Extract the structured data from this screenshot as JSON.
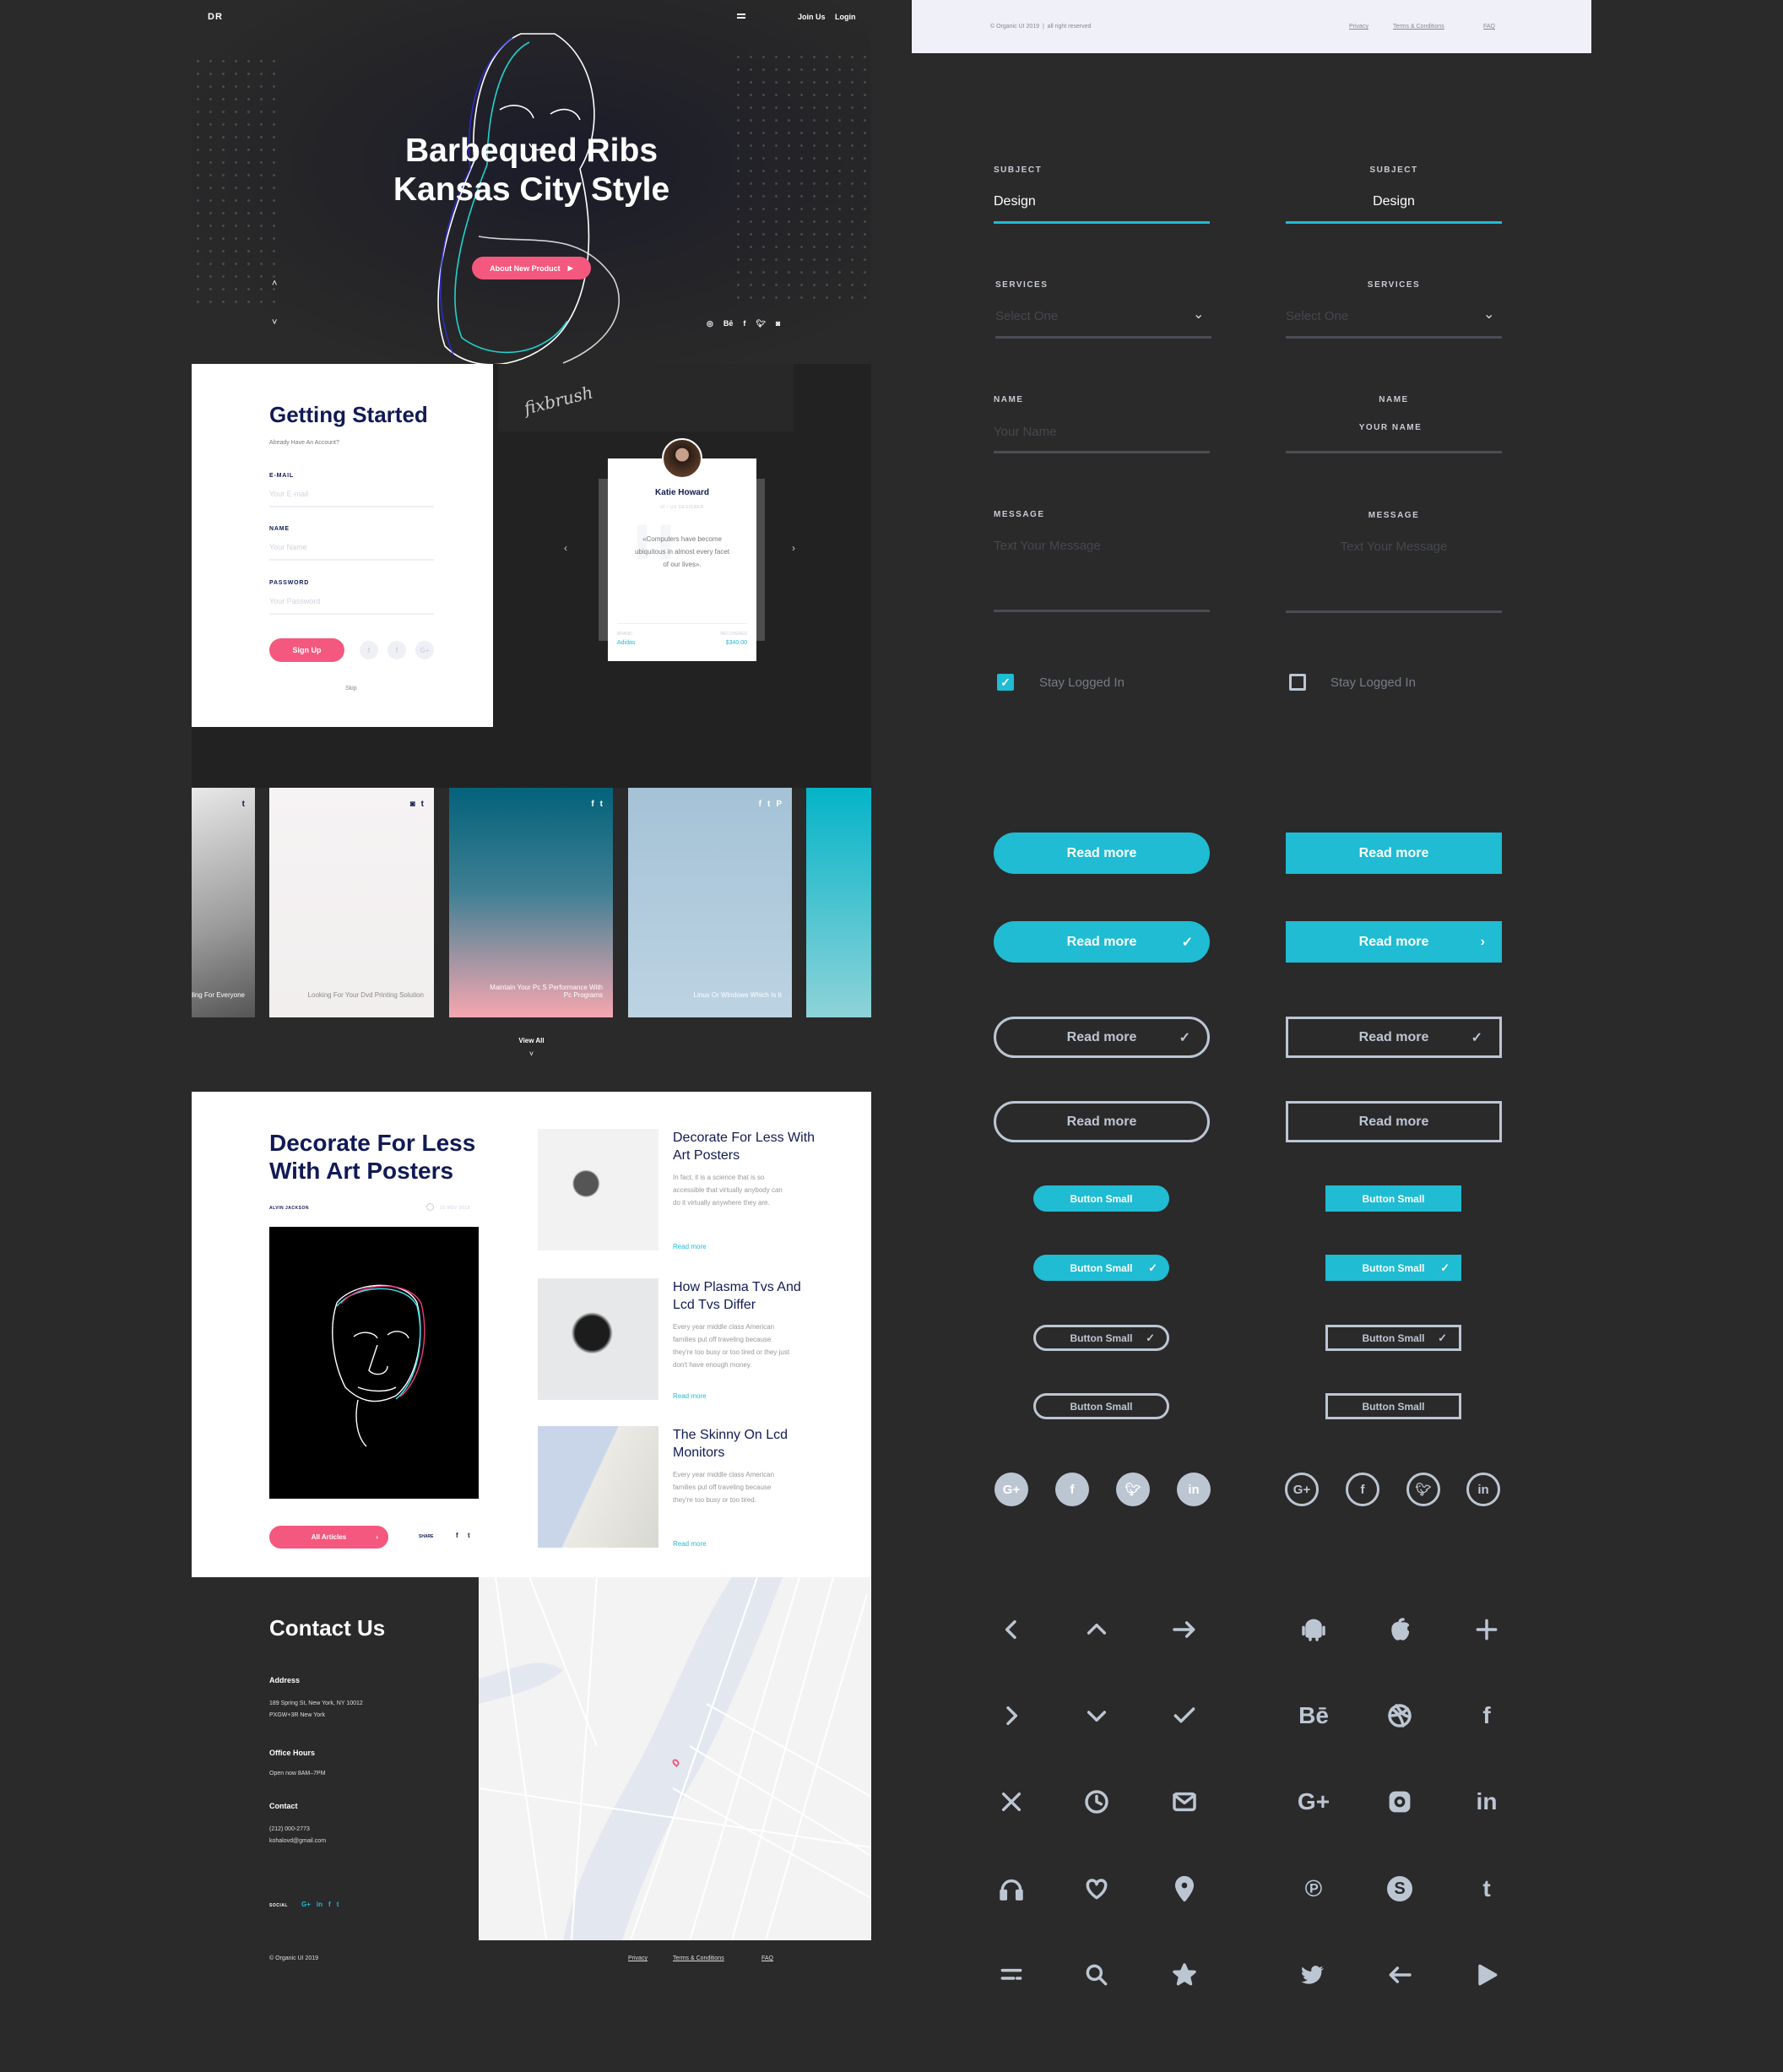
{
  "colors": {
    "accent": "#1fbcd3",
    "pink": "#f4587e",
    "navy": "#111a55",
    "dark": "#2a2a2a",
    "muted": "#bcc6d3"
  },
  "hero": {
    "logo": "DR",
    "nav": [
      "Join Us",
      "Login"
    ],
    "title_line1": "Barbequed Ribs",
    "title_line2": "Kansas City Style",
    "cta": "About New Product",
    "social_icons": [
      "dribbble-icon",
      "behance-icon",
      "facebook-icon",
      "twitter-icon",
      "instagram-icon"
    ],
    "signature": "fixbrush"
  },
  "signup": {
    "title": "Getting Started",
    "subtitle": "Already Have An Account?",
    "fields": [
      {
        "label": "E-MAIL",
        "placeholder": "Your E-mail"
      },
      {
        "label": "NAME",
        "placeholder": "Your Name"
      },
      {
        "label": "PASSWORD",
        "placeholder": "Your Password"
      }
    ],
    "button": "Sign Up",
    "socials": [
      "t",
      "f",
      "G+"
    ],
    "skip": "Skip"
  },
  "testimonial": {
    "name": "Katie Howard",
    "role": "UI / UX DESIGNER",
    "quote": "«Computers have become ubiquitous in almost every facet of our lives».",
    "brand_label": "BRAND:",
    "brand": "Adidas",
    "recovered_label": "RECOVERED",
    "amount": "$340.00"
  },
  "gallery": {
    "cards": [
      {
        "caption": "e Audio Recording For Everyone",
        "icons": [
          "twitter-icon"
        ],
        "bg": "linear-gradient(160deg,#e8e8e8,#9a9a9a 60%,#555)",
        "dark": true
      },
      {
        "caption": "Looking For Your Dvd Printing Solution",
        "icons": [
          "instagram-icon",
          "twitter-icon"
        ],
        "bg": "linear-gradient(#f6f3f4,#f1eeee)",
        "dark": true
      },
      {
        "caption": "Maintain Your Pc S Performance With Pc Programs",
        "icons": [
          "facebook-icon",
          "twitter-icon"
        ],
        "bg": "linear-gradient(#03627a,#3e7f93 45%,#f6a7b0)",
        "dark": false
      },
      {
        "caption": "Linux Or Windows Which Is It",
        "icons": [
          "facebook-icon",
          "twitter-icon",
          "pinterest-icon"
        ],
        "bg": "linear-gradient(#a5c2d6,#bcd3e3)",
        "dark": false
      },
      {
        "caption": "",
        "icons": [],
        "bg": "linear-gradient(#04b4c8,#8ed3d8)",
        "dark": false
      }
    ],
    "view_all": "View All"
  },
  "blog": {
    "title_line1": "Decorate For Less",
    "title_line2": "With Art Posters",
    "author": "ALVIN JACKSON",
    "date": "15 NOV 2019",
    "button": "All Articles",
    "share": "SHARE",
    "posts": [
      {
        "title": "Decorate For Less With Art Posters",
        "excerpt": "In fact, it is a science that is so accessible that virtually anybody can do it virtually anywhere they are.",
        "link": "Read more",
        "bg": "radial-gradient(circle at 40% 45%,#555 0 12%,#f2f2f2 14%)"
      },
      {
        "title": "How Plasma Tvs And Lcd Tvs Differ",
        "excerpt": "Every year middle class American families put off traveling because they're too busy or too tired or they just don't have enough money.",
        "link": "Read more",
        "bg": "radial-gradient(ellipse at 45% 45%,#1c1c1c 0 18%,#e6e8ea 22%)"
      },
      {
        "title": "The Skinny On Lcd Monitors",
        "excerpt": "Every year middle class American families put off traveling because they're too busy or too tired.",
        "link": "Read more",
        "bg": "linear-gradient(115deg,#c9d6ea 45%,#eceae4 46%,#d8d8d2)"
      }
    ]
  },
  "contact": {
    "title": "Contact Us",
    "sections": [
      {
        "heading": "Address",
        "lines": [
          "189 Spring St, New York, NY 10012",
          "PXGW+3R New York"
        ]
      },
      {
        "heading": "Office Hours",
        "lines": [
          "Open now 8AM–7PM"
        ]
      },
      {
        "heading": "Contact",
        "lines": [
          "(212) 000-2773",
          "kohalovd@gmail.com"
        ]
      }
    ],
    "social_label": "SOCIAL",
    "social": [
      "G+",
      "in",
      "f",
      "t"
    ]
  },
  "footer": {
    "copyright": "© Organic UI 2019",
    "links": [
      "Privacy",
      "Terms & Conditions",
      "FAQ"
    ]
  },
  "kit": {
    "top_footer": {
      "copyright": "© Organic UI 2019  |  all right reserved",
      "links": [
        "Privacy",
        "Terms & Conditions",
        "FAQ"
      ]
    },
    "forms": {
      "subject_label": "SUBJECT",
      "subject_value": "Design",
      "services_label": "SERVICES",
      "services_placeholder": "Select One",
      "name_label": "NAME",
      "name_placeholder": "Your Name",
      "name_placeholder_alt": "YOUR NAME",
      "message_label": "MESSAGE",
      "message_placeholder": "Text Your Message",
      "stay_logged": "Stay Logged In",
      "checked_left": true,
      "checked_right": false
    },
    "button_label": "Read more",
    "small_label": "Button Small",
    "social_icons": [
      "G+",
      "f",
      "twitter",
      "in"
    ],
    "icons": [
      "chevron-left",
      "chevron-up",
      "arrow-right",
      "android",
      "apple",
      "plus",
      "chevron-right",
      "chevron-down",
      "check",
      "behance",
      "dribbble",
      "facebook",
      "close",
      "clock",
      "mail",
      "google-plus",
      "instagram",
      "linkedin",
      "headphones",
      "heart",
      "map-pin",
      "pinterest",
      "skype",
      "tumblr",
      "menu",
      "search",
      "star",
      "twitter",
      "arrow-left",
      "play"
    ]
  }
}
